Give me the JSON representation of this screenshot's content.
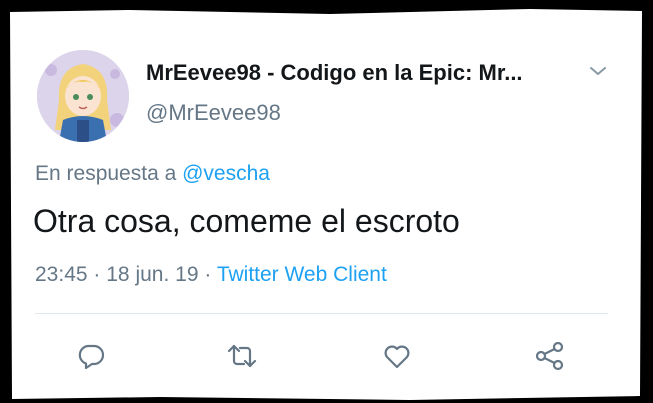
{
  "tweet": {
    "display_name": "MrEevee98 - Codigo en la Epic: Mr...",
    "handle": "@MrEevee98",
    "reply_prefix": "En respuesta a",
    "reply_mention": "@vescha",
    "text": "Otra cosa, comeme el escroto",
    "time": "23:45",
    "date": "18 jun. 19",
    "separator": "·",
    "client": "Twitter Web Client"
  },
  "icons": {
    "more": "chevron-down-icon",
    "reply": "reply-icon",
    "retweet": "retweet-icon",
    "like": "like-icon",
    "share": "share-icon"
  },
  "colors": {
    "link": "#1da1f2",
    "secondary_text": "#657786",
    "primary_text": "#14171a",
    "divider": "#e1e8ed"
  }
}
